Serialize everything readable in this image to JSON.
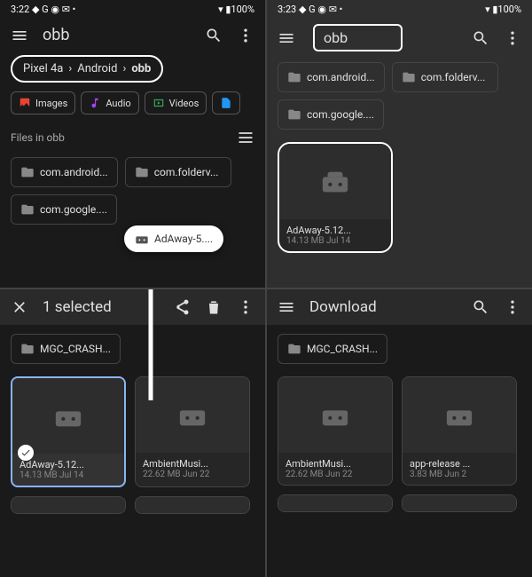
{
  "status": {
    "time1": "3:22",
    "time2": "3:23",
    "icons": "◆ G ◉ ✉ •",
    "batt": "▾ ▮100%"
  },
  "tl": {
    "title": "obb",
    "crumbs": [
      "Pixel 4a",
      "Android",
      "obb"
    ],
    "chips": [
      {
        "label": "Images",
        "color": "#ea4335"
      },
      {
        "label": "Audio",
        "color": "#a142f4"
      },
      {
        "label": "Videos",
        "color": "#34a853"
      }
    ],
    "section": "Files in obb",
    "folders": [
      "com.android...",
      "com.folderv...",
      "com.google...."
    ],
    "drag": "AdAway-5...."
  },
  "tr": {
    "title": "obb",
    "folders": [
      "com.android...",
      "com.folderv...",
      "com.google...."
    ],
    "file": {
      "name": "AdAway-5.12...",
      "sub": "14.13 MB Jul 14"
    }
  },
  "bl": {
    "title": "1 selected",
    "folder": "MGC_CRASH...",
    "files": [
      {
        "name": "AdAway-5.12...",
        "sub": "14.13 MB Jul 14",
        "sel": true
      },
      {
        "name": "AmbientMusi...",
        "sub": "22.62 MB Jun 22"
      }
    ]
  },
  "br": {
    "title": "Download",
    "folder": "MGC_CRASH...",
    "files": [
      {
        "name": "AmbientMusi...",
        "sub": "22.62 MB Jun 22"
      },
      {
        "name": "app-release ...",
        "sub": "3.83 MB Jun 2"
      }
    ]
  }
}
